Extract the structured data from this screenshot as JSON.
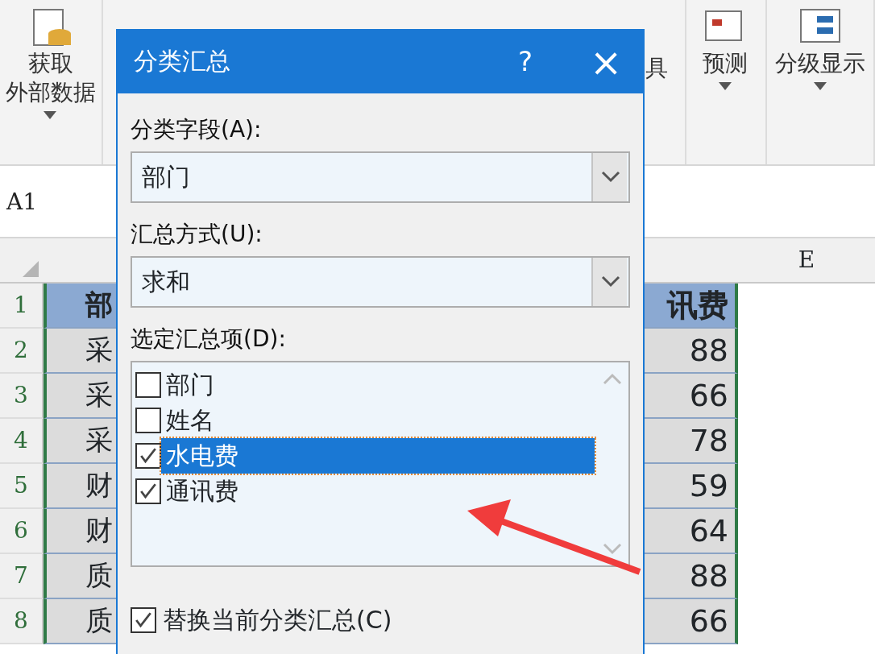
{
  "ribbon": {
    "groups": [
      {
        "label_lines": [
          "获取",
          "外部数据"
        ],
        "caret": true
      },
      {
        "label_lines": [
          "具"
        ],
        "caret": false
      },
      {
        "label_lines": [
          "预测"
        ],
        "caret": true
      },
      {
        "label_lines": [
          "分级显示"
        ],
        "caret": true
      }
    ]
  },
  "name_box": "A1",
  "sheet": {
    "column_headers": [
      "E"
    ],
    "rows": [
      {
        "row": "1",
        "col_a": "部",
        "col_d": "讯费",
        "header": true
      },
      {
        "row": "2",
        "col_a": "采",
        "col_d": "88",
        "header": false
      },
      {
        "row": "3",
        "col_a": "采",
        "col_d": "66",
        "header": false
      },
      {
        "row": "4",
        "col_a": "采",
        "col_d": "78",
        "header": false
      },
      {
        "row": "5",
        "col_a": "财",
        "col_d": "59",
        "header": false
      },
      {
        "row": "6",
        "col_a": "财",
        "col_d": "64",
        "header": false
      },
      {
        "row": "7",
        "col_a": "质",
        "col_d": "88",
        "header": false
      },
      {
        "row": "8",
        "col_a": "质",
        "col_d": "66",
        "header": false
      }
    ]
  },
  "dialog": {
    "title": "分类汇总",
    "help": "?",
    "close": "×",
    "fields": [
      {
        "label": "分类字段(A):",
        "value": "部门"
      },
      {
        "label": "汇总方式(U):",
        "value": "求和"
      }
    ],
    "list_label": "选定汇总项(D):",
    "items": [
      {
        "label": "部门",
        "checked": false,
        "selected": false
      },
      {
        "label": "姓名",
        "checked": false,
        "selected": false
      },
      {
        "label": "水电费",
        "checked": true,
        "selected": true
      },
      {
        "label": "通讯费",
        "checked": true,
        "selected": false
      }
    ],
    "options": [
      {
        "label": "替换当前分类汇总(C)",
        "checked": true
      }
    ]
  }
}
